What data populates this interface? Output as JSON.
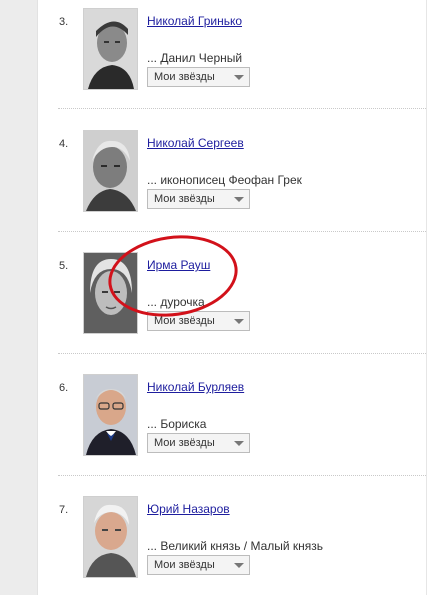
{
  "list": {
    "items": [
      {
        "rank": "3.",
        "name": "Николай Гринько",
        "role": "... Данил Черный",
        "dropdown": "Мои звёзды",
        "photo_icon": "portrait-photo"
      },
      {
        "rank": "4.",
        "name": "Николай Сергеев",
        "role": "... иконописец Феофан Грек",
        "dropdown": "Мои звёзды",
        "photo_icon": "portrait-photo"
      },
      {
        "rank": "5.",
        "name": "Ирма Рауш",
        "role": "... дурочка",
        "dropdown": "Мои звёзды",
        "photo_icon": "portrait-photo"
      },
      {
        "rank": "6.",
        "name": "Николай Бурляев",
        "role": "... Бориска",
        "dropdown": "Мои звёзды",
        "photo_icon": "portrait-photo"
      },
      {
        "rank": "7.",
        "name": "Юрий Назаров",
        "role": "... Великий князь / Малый князь",
        "dropdown": "Мои звёзды",
        "photo_icon": "portrait-photo"
      }
    ]
  },
  "annotation": {
    "color": "#d2111a",
    "shape": "hand-drawn-circle"
  },
  "colors": {
    "link": "#1d1d9e",
    "background": "#ffffff",
    "strip": "#ececec"
  }
}
